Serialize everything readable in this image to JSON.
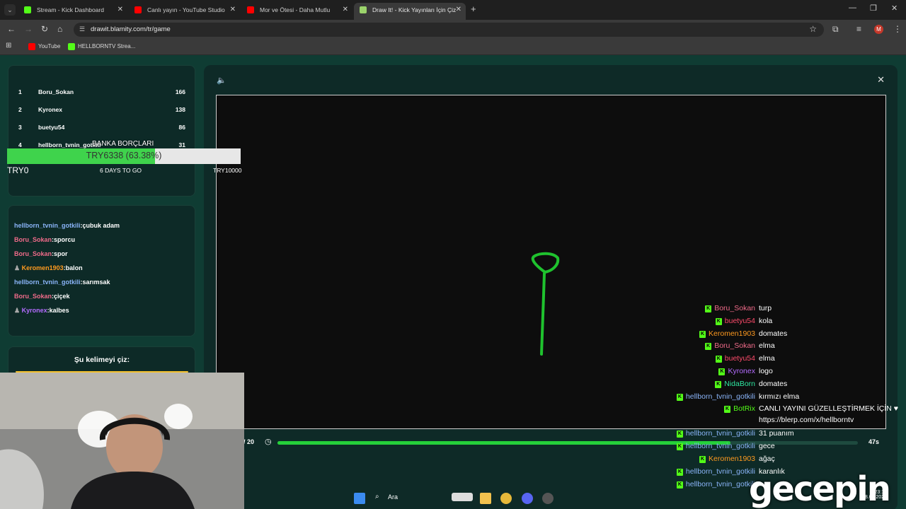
{
  "browser": {
    "tabs": [
      {
        "title": "Stream - Kick Dashboard",
        "color": "#53fc18"
      },
      {
        "title": "Canlı yayın - YouTube Studio",
        "color": "#ff0000"
      },
      {
        "title": "Mor ve Ötesi - Daha Mutlu",
        "color": "#ff0000"
      },
      {
        "title": "Draw It! - Kick Yayınları İçin Çiz",
        "color": "#9bd36b"
      }
    ],
    "url": "drawit.blamity.com/tr/game",
    "bookmarks": [
      {
        "label": "YouTube",
        "color": "#ff0000"
      },
      {
        "label": "HELLBORNTV Strea...",
        "color": "#53fc18"
      }
    ],
    "avatar_letter": "M"
  },
  "leaderboard": [
    {
      "rank": "1",
      "name": "Boru_Sokan",
      "score": "166"
    },
    {
      "rank": "2",
      "name": "Kyronex",
      "score": "138"
    },
    {
      "rank": "3",
      "name": "buetyu54",
      "score": "86"
    },
    {
      "rank": "4",
      "name": "hellborn_tvnin_gotkili",
      "score": "31"
    }
  ],
  "donation": {
    "title": "BANKA BORÇLARI",
    "progress_text": "TRY6338 (63.38%)",
    "progress_fraction": 0.6338,
    "min_label": "TRY0",
    "days_label": "6 DAYS TO GO",
    "max_label": "TRY10000"
  },
  "guesses": [
    {
      "name": "hellborn_tvnin_gotkili",
      "word": "çubuk adam",
      "color": "#8ab4f8",
      "badge": false
    },
    {
      "name": "Boru_Sokan",
      "word": "sporcu",
      "color": "#f06b8a",
      "badge": false
    },
    {
      "name": "Boru_Sokan",
      "word": "spor",
      "color": "#f06b8a",
      "badge": false
    },
    {
      "name": "Keromen1903",
      "word": "balon",
      "color": "#ff9a1f",
      "badge": true
    },
    {
      "name": "hellborn_tvnin_gotkili",
      "word": "sarımsak",
      "color": "#8ab4f8",
      "badge": false
    },
    {
      "name": "Boru_Sokan",
      "word": "çiçek",
      "color": "#f06b8a",
      "badge": false
    },
    {
      "name": "Kyronex",
      "word": "kalbes",
      "color": "#b46cff",
      "badge": true
    }
  ],
  "draw_prompt": "Şu kelimeyi çiz:",
  "game": {
    "round": "/ 20",
    "seconds": "47s",
    "time_fraction": 0.78
  },
  "overlay_chat": [
    {
      "name": "Boru_Sokan",
      "msg": "turp",
      "color": "#f06b8a"
    },
    {
      "name": "buetyu54",
      "msg": "kola",
      "color": "#ff4b6b"
    },
    {
      "name": "Keromen1903",
      "msg": "domates",
      "color": "#ff9a1f"
    },
    {
      "name": "Boru_Sokan",
      "msg": "elma",
      "color": "#f06b8a"
    },
    {
      "name": "buetyu54",
      "msg": "elma",
      "color": "#ff4b6b"
    },
    {
      "name": "Kyronex",
      "msg": "logo",
      "color": "#b46cff"
    },
    {
      "name": "NidaBorn",
      "msg": "domates",
      "color": "#2ee6a0"
    },
    {
      "name": "hellborn_tvnin_gotkili",
      "msg": "kırmızı elma",
      "color": "#8ab4f8"
    },
    {
      "name": "BotRix",
      "msg": "CANLI YAYINI GÜZELLEŞTİRMEK İÇİN ♥",
      "msg2": "https://blerp.com/x/hellborntv",
      "color": "#53fc18"
    },
    {
      "name": "hellborn_tvnin_gotkili",
      "msg": "31 puanım",
      "color": "#8ab4f8"
    },
    {
      "name": "hellborn_tvnin_gotkili",
      "msg": "gece",
      "color": "#8ab4f8"
    },
    {
      "name": "Keromen1903",
      "msg": "ağaç",
      "color": "#ff9a1f"
    },
    {
      "name": "hellborn_tvnin_gotkili",
      "msg": "karanlık",
      "color": "#8ab4f8"
    },
    {
      "name": "hellborn_tvnin_gotkili",
      "msg": "",
      "color": "#8ab4f8"
    }
  ],
  "taskbar": {
    "search_label": "Ara",
    "brand": "gecepin",
    "time": "23:13",
    "date": "28.08.2025"
  },
  "colors": {
    "accent": "#25d03a",
    "stroke": "#1fc22e"
  }
}
